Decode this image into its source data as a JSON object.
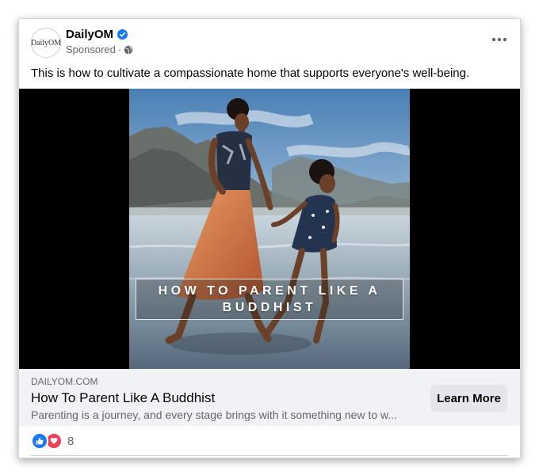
{
  "post": {
    "page_name": "DailyOM",
    "logo_text": "DailyOM",
    "sponsored": "Sponsored",
    "separator": "·",
    "caption": "This is how to cultivate a compassionate home that supports everyone's well-being."
  },
  "media": {
    "overlay_text": "HOW TO PARENT LIKE A BUDDHIST"
  },
  "link": {
    "domain": "DAILYOM.COM",
    "title": "How To Parent Like A Buddhist",
    "description": "Parenting is a journey, and every stage brings with it something new to w...",
    "cta": "Learn More"
  },
  "reactions": {
    "count": "8",
    "types": [
      "like-icon",
      "love-icon"
    ]
  },
  "colors": {
    "brand_blue": "#1877f2",
    "love_red": "#f33e58",
    "link_bg": "#f0f2f5",
    "button_bg": "#e4e6eb"
  }
}
